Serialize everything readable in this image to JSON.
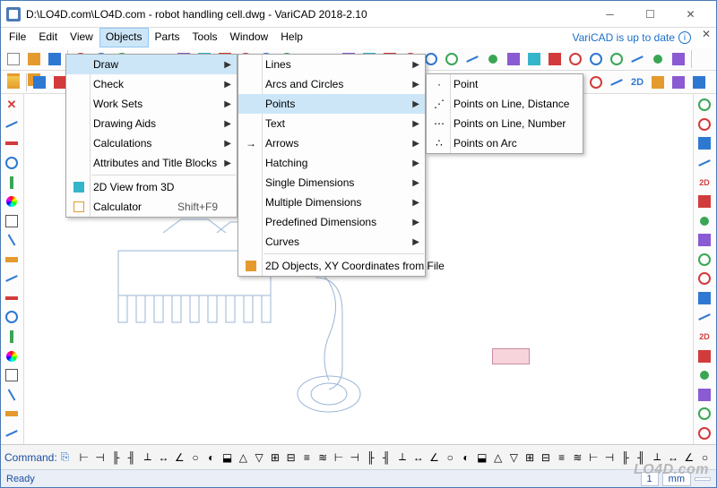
{
  "window": {
    "title": "D:\\LO4D.com\\LO4D.com - robot handling cell.dwg - VariCAD 2018-2.10",
    "update_text": "VariCAD is up to date"
  },
  "menubar": [
    "File",
    "Edit",
    "View",
    "Objects",
    "Parts",
    "Tools",
    "Window",
    "Help"
  ],
  "menu_objects": [
    {
      "label": "Draw",
      "sub": true,
      "hover": true
    },
    {
      "label": "Check",
      "sub": true
    },
    {
      "label": "Work Sets",
      "sub": true
    },
    {
      "label": "Drawing Aids",
      "sub": true
    },
    {
      "label": "Calculations",
      "sub": true
    },
    {
      "label": "Attributes and Title Blocks",
      "sub": true
    },
    {
      "sep": true
    },
    {
      "label": "2D View from 3D",
      "icon": "view2d"
    },
    {
      "label": "Calculator",
      "shortcut": "Shift+F9",
      "icon": "calc"
    }
  ],
  "menu_draw": [
    {
      "label": "Lines",
      "sub": true
    },
    {
      "label": "Arcs and Circles",
      "sub": true
    },
    {
      "label": "Points",
      "sub": true,
      "hover": true
    },
    {
      "label": "Text",
      "sub": true
    },
    {
      "label": "Arrows",
      "sub": true,
      "icon": "arrow"
    },
    {
      "label": "Hatching",
      "sub": true
    },
    {
      "label": "Single Dimensions",
      "sub": true
    },
    {
      "label": "Multiple Dimensions",
      "sub": true
    },
    {
      "label": "Predefined Dimensions",
      "sub": true
    },
    {
      "label": "Curves",
      "sub": true
    },
    {
      "sep": true
    },
    {
      "label": "2D Objects, XY Coordinates from File",
      "icon": "file2d"
    }
  ],
  "menu_points": [
    {
      "label": "Point",
      "icon": "pt"
    },
    {
      "label": "Points on Line, Distance",
      "icon": "ptd"
    },
    {
      "label": "Points on Line, Number",
      "icon": "ptn"
    },
    {
      "label": "Points on Arc",
      "icon": "pta"
    }
  ],
  "command_label": "Command:",
  "status": {
    "ready": "Ready",
    "unit": "mm",
    "scale": "1"
  },
  "watermark": "LO4D.com"
}
